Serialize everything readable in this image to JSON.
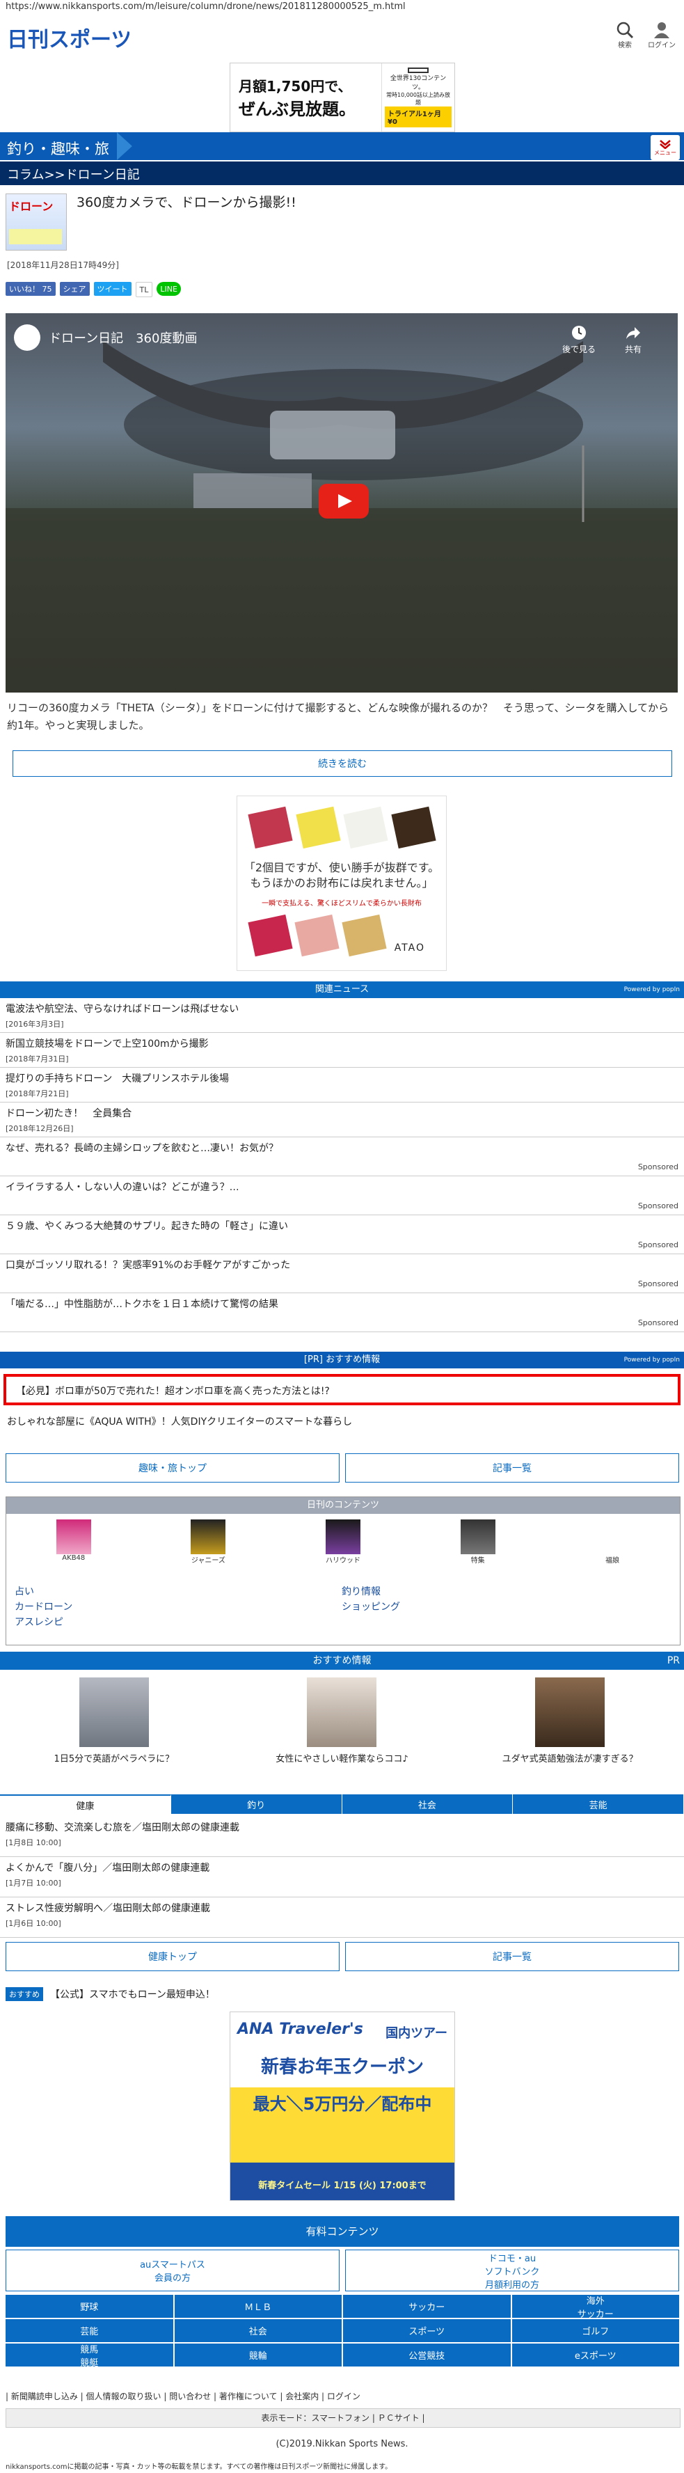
{
  "url": "https://www.nikkansports.com/m/leisure/column/drone/news/201811280000525_m.html",
  "logo_text": "日刊スポーツ",
  "header": {
    "search": "検索",
    "login": "ログイン"
  },
  "ad_top": {
    "line1": "月額1,750円で、",
    "line2": "ぜんぶ見放題。",
    "r1": "全世界130コンテンツ。",
    "r2": "常時10,000話以上読み放題",
    "cta": "トライアル1ヶ月 ¥0"
  },
  "category": {
    "label": "釣り・趣味・旅",
    "menu": "メニュー"
  },
  "breadcrumb": "コラム>>ドローン日記",
  "article": {
    "title": "360度カメラで、ドローンから撮影!!",
    "date": "[2018年11月28日17時49分]",
    "lead": "リコーの360度カメラ「THETA（シータ）」をドローンに付けて撮影すると、どんな映像が撮れるのか？　そう思って、シータを購入してから約1年。やっと実現しました。",
    "readmore": "続きを読む"
  },
  "social": {
    "like": "いいね！ 75",
    "share": "シェア",
    "tweet": "ツイート",
    "tl": "TL",
    "line": "LINE"
  },
  "video": {
    "title": "ドローン日記　360度動画",
    "later": "後で見る",
    "share": "共有"
  },
  "ad_mid": {
    "msg1": "「2個目ですが、使い勝手が抜群です。",
    "msg2": "もうほかのお財布には戻れません。」",
    "sub": "一瞬で支払える、驚くほどスリムで柔らかい長財布",
    "brand": "ATAO"
  },
  "related": {
    "head": "関連ニュース",
    "powered": "Powered by popIn",
    "items": [
      {
        "title": "電波法や航空法、守らなければドローンは飛ばせない",
        "date": "[2016年3月3日]"
      },
      {
        "title": "新国立競技場をドローンで上空100mから撮影",
        "date": "[2018年7月31日]"
      },
      {
        "title": "提灯りの手持ちドローン　大磯プリンスホテル後場",
        "date": "[2018年7月21日]"
      },
      {
        "title": "ドローン初たき！　全員集合",
        "date": "[2018年12月26日]"
      }
    ],
    "sponsored": [
      {
        "title": "なぜ、売れる？長崎の主婦シロップを飲むと…凄い！お気が？",
        "label": "Sponsored"
      },
      {
        "title": "イライラする人・しない人の違いは？どこが違う？…",
        "label": "Sponsored"
      },
      {
        "title": "５９歳、やくみつる大絶賛のサプリ。起きた時の「軽さ」に違い",
        "label": "Sponsored"
      },
      {
        "title": "口臭がゴッソリ取れる！？実感率91%のお手軽ケアがすごかった",
        "label": "Sponsored"
      },
      {
        "title": "「噛だる…」中性脂肪が…トクホを１日１本続けて驚愕の結果",
        "label": "Sponsored"
      }
    ]
  },
  "pr": {
    "head": "[PR] おすすめ情報",
    "powered": "Powered by popIn",
    "item1": "【必見】ボロ車が50万で売れた！超オンボロ車を高く売った方法とは!?",
    "item2": "おしゃれな部屋に《AQUA WITH》！人気DIYクリエイターのスマートな暮らし"
  },
  "nav_buttons": {
    "top": "趣味・旅トップ",
    "list": "記事一覧"
  },
  "nikkan_contents": {
    "head": "日刊のコンテンツ",
    "items": [
      "AKB48",
      "ジャニーズ",
      "ハリウッド",
      "特集",
      "福娘"
    ],
    "links_left": [
      "占い",
      "カードローン",
      "アスレシピ"
    ],
    "links_right": [
      "釣り情報",
      "ショッピング"
    ]
  },
  "recommend": {
    "head": "おすすめ情報",
    "pr": "PR",
    "items": [
      "1日5分で英語がペラペラに？",
      "女性にやさしい軽作業ならココ♪",
      "ユダヤ式英語勉強法が凄すぎる？"
    ]
  },
  "tabs": [
    "健康",
    "釣り",
    "社会",
    "芸能"
  ],
  "health_list": [
    {
      "title": "腰痛に移動、交流楽しむ旅を／塩田剛太郎の健康連載",
      "date": "[1月8日 10:00]"
    },
    {
      "title": "よくかんで「腹八分」／塩田剛太郎の健康連載",
      "date": "[1月7日 10:00]"
    },
    {
      "title": "ストレス性疲労解明へ／塩田剛太郎の健康連載",
      "date": "[1月6日 10:00]"
    }
  ],
  "health_buttons": {
    "top": "健康トップ",
    "list": "記事一覧"
  },
  "osusume": {
    "tag": "おすすめ",
    "text": "【公式】スマホでもローン最短申込！"
  },
  "ad_bot": {
    "brand": "ANA Traveler's",
    "type": "国内ツアー",
    "line1": "新春お年玉クーポン",
    "line2": "最大＼5万円分／配布中",
    "sale": "新春タイムセール 1/15 (火) 17:00まで"
  },
  "paid": {
    "head": "有料コンテンツ",
    "left": "auスマートパス\n会員の方",
    "right": "ドコモ・au\nソフトバンク\n月額利用の方"
  },
  "grid": [
    "野球",
    "ＭＬＢ",
    "サッカー",
    "海外\nサッカー",
    "芸能",
    "社会",
    "スポーツ",
    "ゴルフ",
    "競馬\n競艇",
    "競輪",
    "公営競技",
    "eスポーツ"
  ],
  "footer": {
    "links": "| 新聞購読申し込み | 個人情報の取り扱い | 問い合わせ | 著作権について | 会社案内 | ログイン",
    "mode": "表示モード：スマートフォン | ＰＣサイト |",
    "copyright": "(C)2019.Nikkan Sports News.",
    "notice": "nikkansports.comに掲載の記事・写真・カット等の転載を禁じます。すべての著作権は日刊スポーツ新聞社に帰属します。"
  },
  "colors": {
    "primary": "#0a6bc2",
    "dark": "#042c64",
    "red": "#e00000"
  }
}
